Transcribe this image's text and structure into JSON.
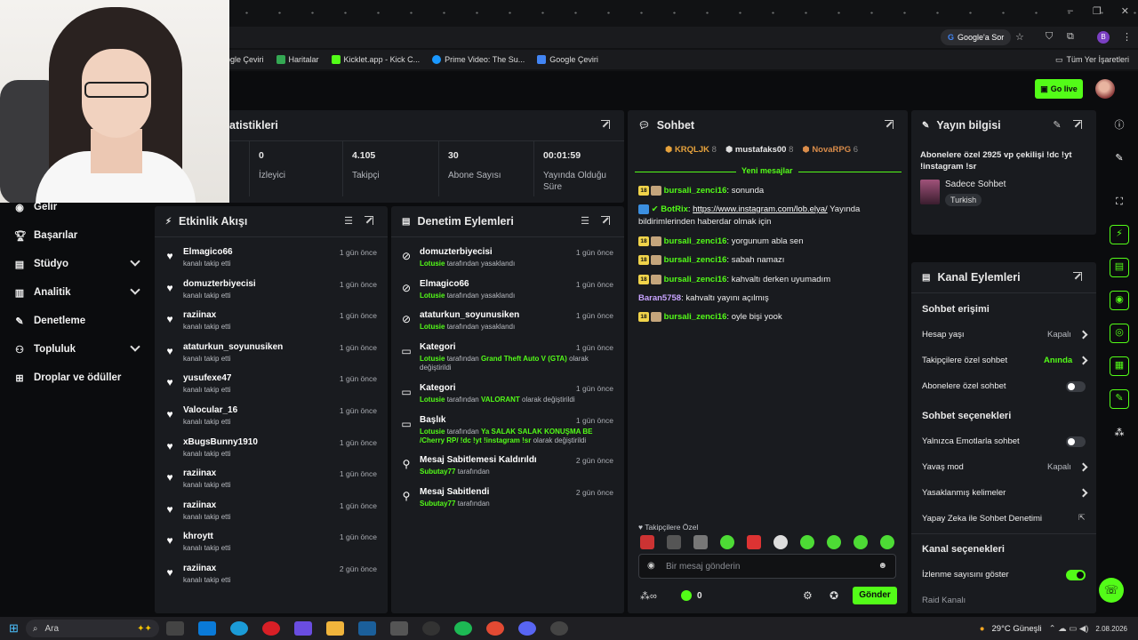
{
  "browser": {
    "search_chip": "Google'a Sor",
    "bookmarks": [
      "ogle Çeviri",
      "Haritalar",
      "Kicklet.app - Kick C...",
      "Prime Video: The Su...",
      "Google Çeviri"
    ],
    "all_bookmarks": "Tüm Yer İşaretleri",
    "profile_initial": "B"
  },
  "header": {
    "go_live": "Go live"
  },
  "sidebar": {
    "items": [
      {
        "label": "Gelir",
        "icon": "coin-icon"
      },
      {
        "label": "Başarılar",
        "icon": "trophy-icon"
      },
      {
        "label": "Stüdyo",
        "icon": "studio-icon"
      },
      {
        "label": "Analitik",
        "icon": "chart-icon"
      },
      {
        "label": "Denetleme",
        "icon": "wrench-icon"
      },
      {
        "label": "Topluluk",
        "icon": "community-icon"
      },
      {
        "label": "Droplar ve ödüller",
        "icon": "gift-icon"
      }
    ]
  },
  "stats": {
    "title": "atistikleri",
    "items": [
      {
        "value": "0",
        "label": "İzleyici"
      },
      {
        "value": "4.105",
        "label": "Takipçi"
      },
      {
        "value": "30",
        "label": "Abone Sayısı"
      },
      {
        "value": "00:01:59",
        "label": "Yayında Olduğu Süre"
      }
    ]
  },
  "activity": {
    "title": "Etkinlik Akışı",
    "sub": "kanalı takip etti",
    "items": [
      {
        "name": "Elmagico66",
        "time": "1 gün önce"
      },
      {
        "name": "domuzterbiyecisi",
        "time": "1 gün önce"
      },
      {
        "name": "raziinax",
        "time": "1 gün önce"
      },
      {
        "name": "ataturkun_soyunusiken",
        "time": "1 gün önce"
      },
      {
        "name": "yusufexe47",
        "time": "1 gün önce"
      },
      {
        "name": "Valocular_16",
        "time": "1 gün önce"
      },
      {
        "name": "xBugsBunny1910",
        "time": "1 gün önce"
      },
      {
        "name": "raziinax",
        "time": "1 gün önce"
      },
      {
        "name": "raziinax",
        "time": "1 gün önce"
      },
      {
        "name": "khroytt",
        "time": "1 gün önce"
      },
      {
        "name": "raziinax",
        "time": "2 gün önce"
      }
    ]
  },
  "moderation": {
    "title": "Denetim Eylemleri",
    "items": [
      {
        "name": "domuzterbiyecisi",
        "time": "1 gün önce",
        "actor": "Lotusie",
        "rest": "tarafından yasaklandı"
      },
      {
        "name": "Elmagico66",
        "time": "1 gün önce",
        "actor": "Lotusie",
        "rest": "tarafından yasaklandı"
      },
      {
        "name": "ataturkun_soyunusiken",
        "time": "1 gün önce",
        "actor": "Lotusie",
        "rest": "tarafından yasaklandı"
      },
      {
        "name": "Kategori",
        "time": "1 gün önce",
        "actor": "Lotusie",
        "mid": "tarafından",
        "hl": "Grand Theft Auto V (GTA)",
        "rest": "olarak değiştirildi"
      },
      {
        "name": "Kategori",
        "time": "1 gün önce",
        "actor": "Lotusie",
        "mid": "tarafından",
        "hl": "VALORANT",
        "rest": "olarak değiştirildi"
      },
      {
        "name": "Başlık",
        "time": "1 gün önce",
        "actor": "Lotusie",
        "mid": "tarafından",
        "hl": "Ya SALAK SALAK KONUŞMA BE /Cherry RP/ !dc !yt !instagram !sr",
        "rest": "olarak değiştirildi"
      },
      {
        "name": "Mesaj Sabitlemesi Kaldırıldı",
        "time": "2 gün önce",
        "actor": "Subutay77",
        "rest": "tarafından"
      },
      {
        "name": "Mesaj Sabitlendi",
        "time": "2 gün önce",
        "actor": "Subutay77",
        "rest": "tarafından"
      }
    ]
  },
  "chat": {
    "title": "Sohbet",
    "top": [
      {
        "name": "KRQLJK",
        "n": "8"
      },
      {
        "name": "mustafaks00",
        "n": "8"
      },
      {
        "name": "NovaRPG",
        "n": "6"
      }
    ],
    "new_messages": "Yeni mesajlar",
    "messages": [
      {
        "user": "bursali_zenci16",
        "text": "sonunda"
      },
      {
        "user": "BotRix",
        "link": "https://www.instagram.com/lob.elya/",
        "text": "Yayında bildirimlerinden haberdar olmak için"
      },
      {
        "user": "bursali_zenci16",
        "text": "yorgunum abla sen"
      },
      {
        "user": "bursali_zenci16",
        "text": "sabah namazı"
      },
      {
        "user": "bursali_zenci16",
        "text": "kahvaltı derken uyumadım"
      },
      {
        "user": "Baran5758",
        "text": "kahvaltı yayını açılmış"
      },
      {
        "user": "bursali_zenci16",
        "text": "oyle bişi yook"
      }
    ],
    "followers_only": "Takipçilere Özel",
    "placeholder": "Bir mesaj gönderin",
    "points": "0",
    "send": "Gönder"
  },
  "stream_info": {
    "title": "Yayın bilgisi",
    "stream_title": "Abonelere özel 2925 vp çekilişi !dc !yt !instagram !sr",
    "category": "Sadece Sohbet",
    "tag": "Turkish"
  },
  "channel_actions": {
    "title": "Kanal Eylemleri",
    "sec1": "Sohbet erişimi",
    "account_age": "Hesap yaşı",
    "account_age_val": "Kapalı",
    "followers_chat": "Takipçilere özel sohbet",
    "followers_chat_val": "Anında",
    "subs_chat": "Abonelere özel sohbet",
    "sec2": "Sohbet seçenekleri",
    "emote_only": "Yalnızca Emotlarla sohbet",
    "slow": "Yavaş mod",
    "slow_val": "Kapalı",
    "banned_words": "Yasaklanmış kelimeler",
    "ai_mod": "Yapay Zeka ile Sohbet Denetimi",
    "sec3": "Kanal seçenekleri",
    "show_views": "İzlenme sayısını göster",
    "raid": "Raid Kanalı"
  },
  "taskbar": {
    "search": "Ara",
    "weather": "29°C  Güneşli",
    "date": "2.08.2026"
  },
  "colors": {
    "accent": "#53fc18",
    "panel": "#191b1f",
    "bg": "#0b0c0e"
  }
}
